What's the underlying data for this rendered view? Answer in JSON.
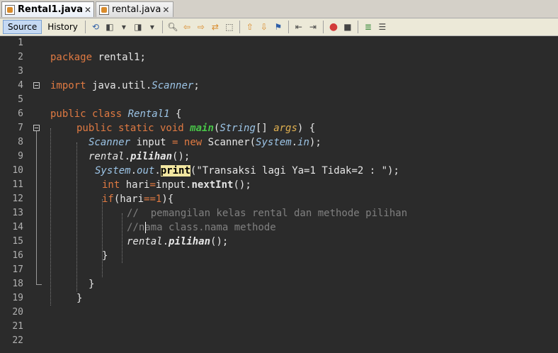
{
  "tabs": [
    {
      "label": "Rental1.java",
      "active": true
    },
    {
      "label": "rental.java",
      "active": false
    }
  ],
  "toolbar": {
    "source_label": "Source",
    "history_label": "History"
  },
  "line_numbers": [
    "1",
    "2",
    "3",
    "4",
    "5",
    "6",
    "7",
    "8",
    "9",
    "10",
    "11",
    "12",
    "13",
    "14",
    "15",
    "16",
    "17",
    "18",
    "19",
    "20",
    "21",
    "22"
  ],
  "code": {
    "l2": {
      "kw": "package",
      "rest": " rental1;"
    },
    "l4": {
      "kw": "import",
      "a": " java.util.",
      "cls": "Scanner",
      "b": ";"
    },
    "l6": {
      "kw": "public class",
      "cls": "Rental1",
      "rest": " {"
    },
    "l7": {
      "kw": "public static void",
      "method": "main",
      "a": "(",
      "type": "String",
      "b": "[] ",
      "param": "args",
      "c": ") {"
    },
    "l8": {
      "type": "Scanner",
      "a": " input ",
      "op": "=",
      "kw": " new",
      "b": " Scanner(",
      "sys": "System",
      "dot": ".",
      "fld": "in",
      "c": ");"
    },
    "l9": {
      "obj": "rental",
      "dot": ".",
      "meth": "pilihan",
      "rest": "();"
    },
    "l10": {
      "sys": "System",
      "d1": ".",
      "fld": "out",
      "d2": ".",
      "meth": "print",
      "str": "(\"Transaksi lagi Ya=1 Tidak=2 : \");"
    },
    "l11": {
      "kw": "int",
      "a": " hari",
      "op": "=",
      "b": "input.",
      "meth": "nextInt",
      "c": "();"
    },
    "l12": {
      "kw": "if",
      "a": "(hari",
      "op": "==",
      "num": "1",
      "b": "){"
    },
    "l13": {
      "comment": "//  pemangilan kelas rental dan methode pilihan"
    },
    "l14": {
      "comment": "//nama class.nama methode"
    },
    "l15": {
      "obj": "rental",
      "dot": ".",
      "meth": "pilihan",
      "rest": "();"
    },
    "l16": {
      "rest": "}"
    },
    "l18": {
      "rest": "}"
    },
    "l19": {
      "rest": "}"
    }
  }
}
